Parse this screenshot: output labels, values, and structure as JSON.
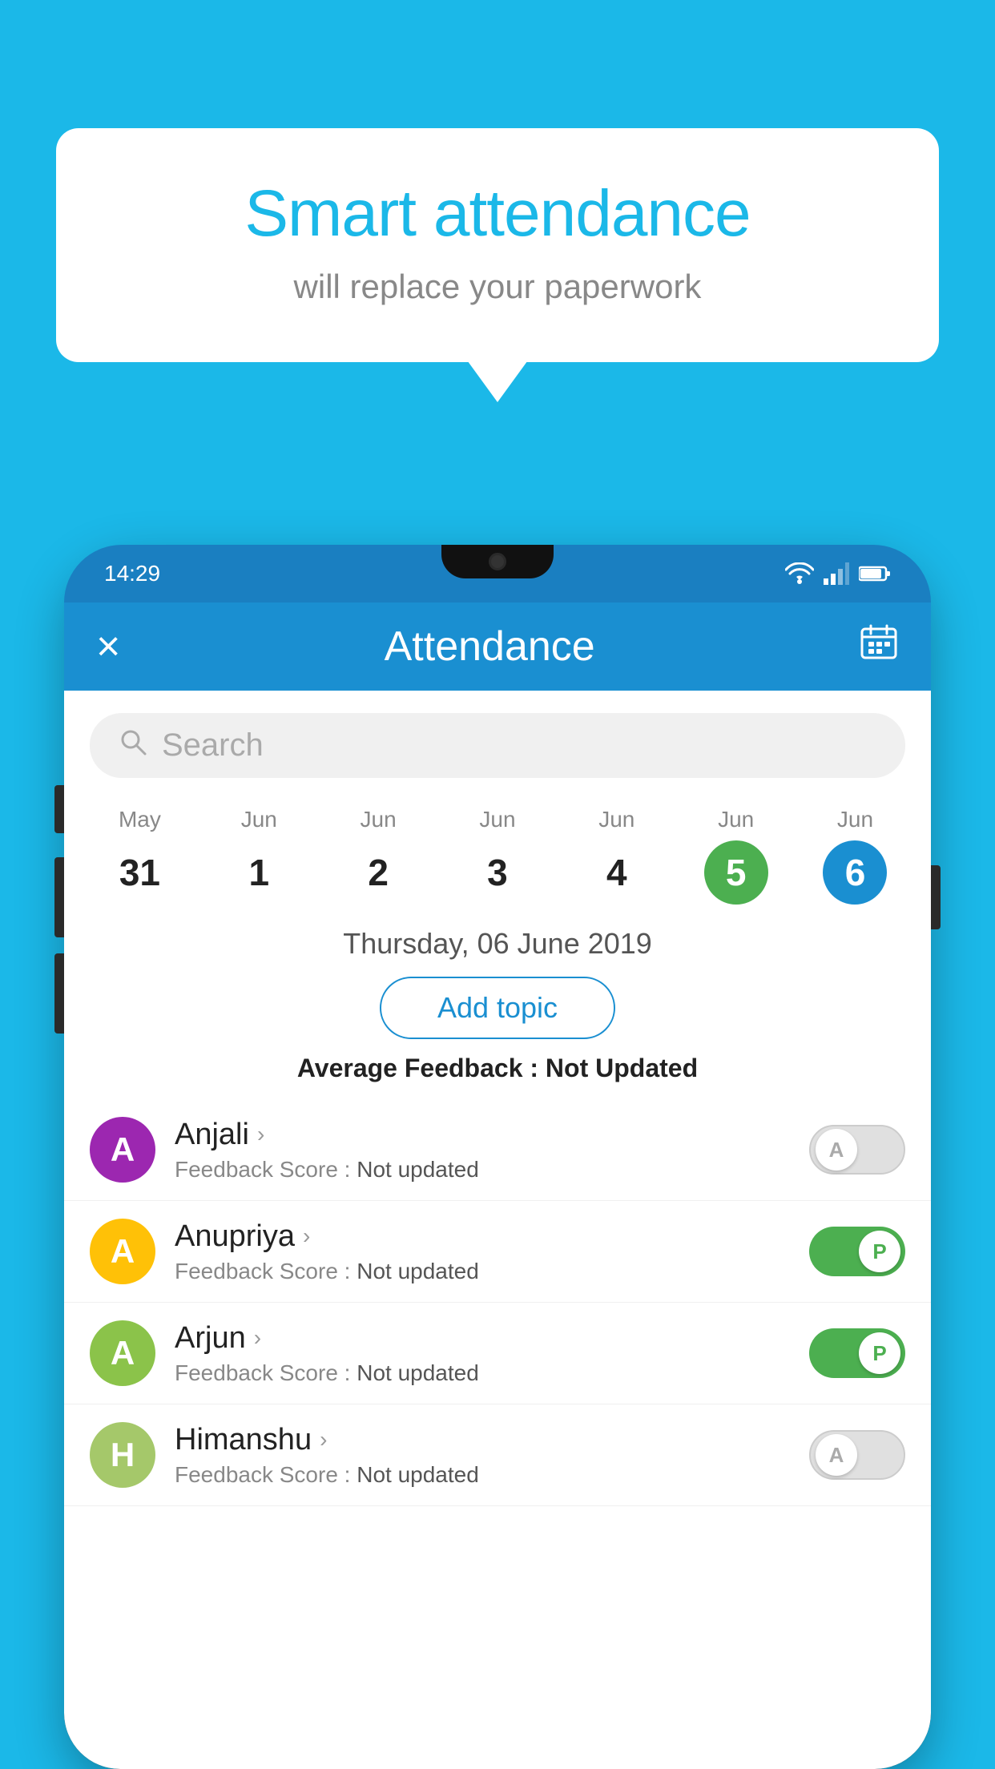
{
  "background_color": "#1BB8E8",
  "bubble": {
    "title": "Smart attendance",
    "subtitle": "will replace your paperwork"
  },
  "status_bar": {
    "time": "14:29",
    "wifi_icon": "wifi-icon",
    "signal_icon": "signal-icon",
    "battery_icon": "battery-icon"
  },
  "app_bar": {
    "close_label": "×",
    "title": "Attendance",
    "calendar_icon": "calendar-icon"
  },
  "search": {
    "placeholder": "Search"
  },
  "calendar": {
    "days": [
      {
        "month": "May",
        "date": "31",
        "state": "normal"
      },
      {
        "month": "Jun",
        "date": "1",
        "state": "normal"
      },
      {
        "month": "Jun",
        "date": "2",
        "state": "normal"
      },
      {
        "month": "Jun",
        "date": "3",
        "state": "normal"
      },
      {
        "month": "Jun",
        "date": "4",
        "state": "normal"
      },
      {
        "month": "Jun",
        "date": "5",
        "state": "today"
      },
      {
        "month": "Jun",
        "date": "6",
        "state": "selected"
      }
    ]
  },
  "selected_date": "Thursday, 06 June 2019",
  "add_topic_label": "Add topic",
  "average_feedback": {
    "label": "Average Feedback :",
    "value": "Not Updated"
  },
  "students": [
    {
      "name": "Anjali",
      "avatar_letter": "A",
      "avatar_color": "#9C27B0",
      "feedback_label": "Feedback Score :",
      "feedback_value": "Not updated",
      "toggle_state": "off",
      "toggle_label": "A"
    },
    {
      "name": "Anupriya",
      "avatar_letter": "A",
      "avatar_color": "#FFC107",
      "feedback_label": "Feedback Score :",
      "feedback_value": "Not updated",
      "toggle_state": "on",
      "toggle_label": "P"
    },
    {
      "name": "Arjun",
      "avatar_letter": "A",
      "avatar_color": "#8BC34A",
      "feedback_label": "Feedback Score :",
      "feedback_value": "Not updated",
      "toggle_state": "on",
      "toggle_label": "P"
    },
    {
      "name": "Himanshu",
      "avatar_letter": "H",
      "avatar_color": "#A5C86A",
      "feedback_label": "Feedback Score :",
      "feedback_value": "Not updated",
      "toggle_state": "off",
      "toggle_label": "A"
    }
  ]
}
